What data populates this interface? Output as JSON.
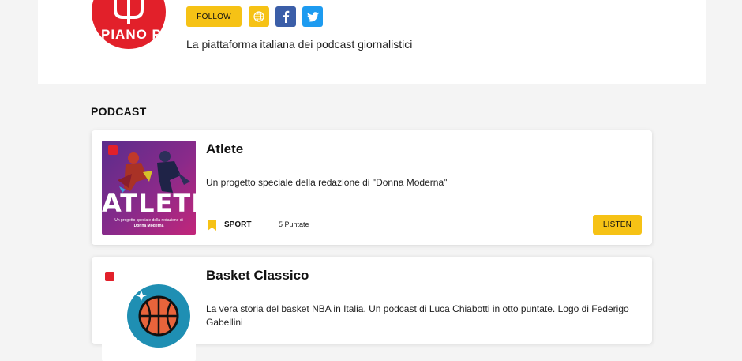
{
  "header": {
    "logo_text": "PIANO P",
    "follow_label": "FOLLOW",
    "tagline": "La piattaforma italiana dei podcast giornalistici",
    "social_icons": [
      "globe-icon",
      "facebook-icon",
      "twitter-icon"
    ]
  },
  "section": {
    "title": "PODCAST"
  },
  "podcasts": [
    {
      "title": "Atlete",
      "description": "Un progetto speciale della redazione di \"Donna Moderna\"",
      "cover_title": "ATLETE",
      "cover_subtitle": "Un progetto speciale della redazione di",
      "cover_brand": "Donna Moderna",
      "category": "SPORT",
      "episodes": "5 Puntate",
      "listen_label": "LISTEN"
    },
    {
      "title": "Basket Classico",
      "description": "La vera storia del basket NBA in Italia. Un podcast di Luca Chiabotti in otto puntate. Logo di Federigo Gabellini"
    }
  ],
  "colors": {
    "accent_yellow": "#f6c215",
    "brand_red": "#e2202a",
    "facebook_blue": "#3b5ea8",
    "twitter_blue": "#1d9bf0"
  }
}
